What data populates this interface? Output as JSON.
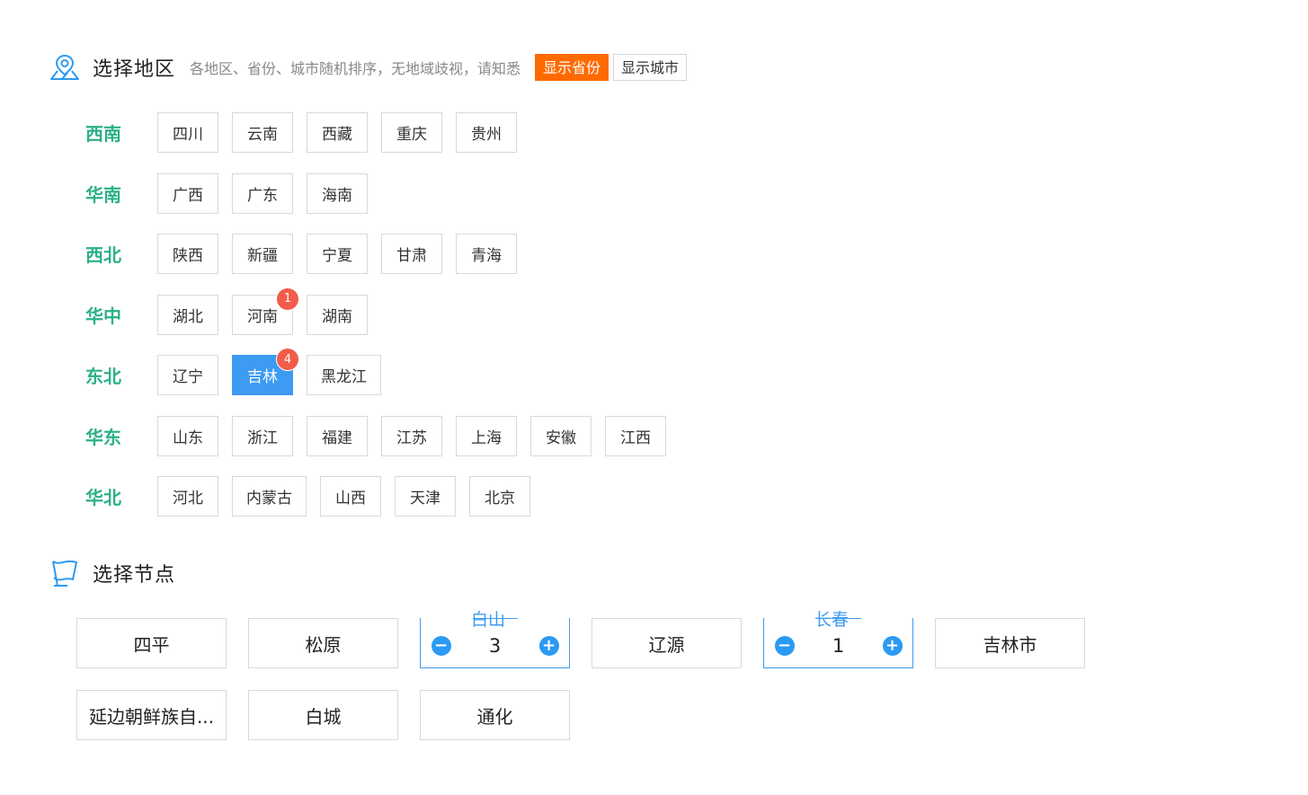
{
  "region_section": {
    "title": "选择地区",
    "hint": "各地区、省份、城市随机排序，无地域歧视，请知悉",
    "toggle_province": "显示省份",
    "toggle_city": "显示城市"
  },
  "regions": [
    {
      "label": "西南",
      "provinces": [
        "四川",
        "云南",
        "西藏",
        "重庆",
        "贵州"
      ]
    },
    {
      "label": "华南",
      "provinces": [
        "广西",
        "广东",
        "海南"
      ]
    },
    {
      "label": "西北",
      "provinces": [
        "陕西",
        "新疆",
        "宁夏",
        "甘肃",
        "青海"
      ]
    },
    {
      "label": "华中",
      "provinces": [
        "湖北",
        "河南",
        "湖南"
      ]
    },
    {
      "label": "东北",
      "provinces": [
        "辽宁",
        "吉林",
        "黑龙江"
      ]
    },
    {
      "label": "华东",
      "provinces": [
        "山东",
        "浙江",
        "福建",
        "江苏",
        "上海",
        "安徽",
        "江西"
      ]
    },
    {
      "label": "华北",
      "provinces": [
        "河北",
        "内蒙古",
        "山西",
        "天津",
        "北京"
      ]
    }
  ],
  "badges": {
    "华中": {
      "河南": "1"
    },
    "东北": {
      "吉林": "4"
    }
  },
  "selected_province": "吉林",
  "node_section": {
    "title": "选择节点"
  },
  "nodes": [
    {
      "name": "四平"
    },
    {
      "name": "松原"
    },
    {
      "name": "白山",
      "count": "3"
    },
    {
      "name": "辽源"
    },
    {
      "name": "长春",
      "count": "1"
    },
    {
      "name": "吉林市"
    },
    {
      "name": "延边朝鲜族自..."
    },
    {
      "name": "白城"
    },
    {
      "name": "通化"
    }
  ],
  "colors": {
    "accent": "#3d9bf2",
    "region_label": "#2bb089",
    "active_toggle": "#ff6a00",
    "badge": "#f25c4a"
  }
}
